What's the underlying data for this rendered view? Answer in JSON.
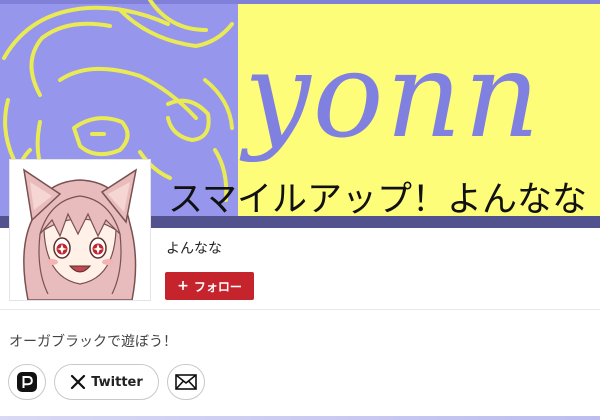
{
  "header": {
    "banner_word": "yonn",
    "site_title": "スマイルアップ！よんなな"
  },
  "profile": {
    "username": "よんなな",
    "follow_label": "フォロー",
    "follow_icon": "plus-icon",
    "bio": "オーガブラックで遊ぼう！"
  },
  "links": {
    "pixiv_icon": "pixiv-icon",
    "twitter_label": "Twitter",
    "twitter_icon": "x-logo-icon",
    "mail_icon": "mail-icon"
  },
  "colors": {
    "header_purple": "#9696ec",
    "header_yellow": "#fdfd7a",
    "banner_text": "#8080e0",
    "follow_button": "#c5242c",
    "sketch_lines": "#eaea55"
  }
}
